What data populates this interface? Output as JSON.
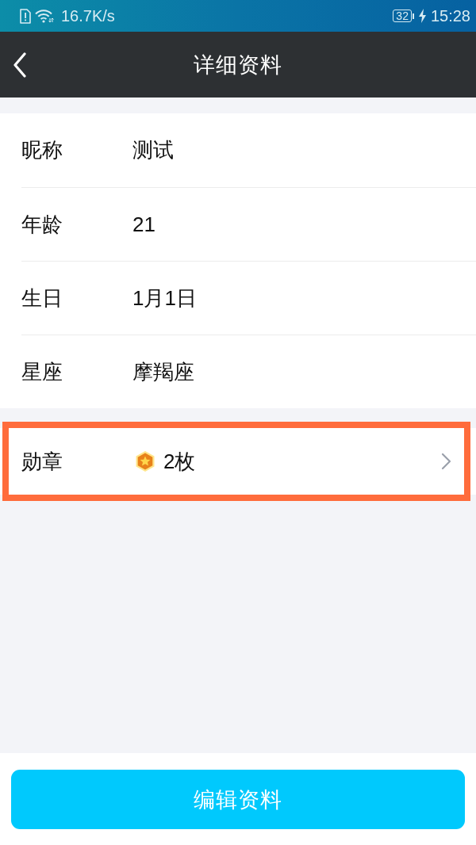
{
  "status_bar": {
    "network_speed": "16.7K/s",
    "battery": "32",
    "charging": true,
    "time": "15:28"
  },
  "nav_bar": {
    "title": "详细资料"
  },
  "profile_fields": [
    {
      "label": "昵称",
      "value": "测试"
    },
    {
      "label": "年龄",
      "value": "21"
    },
    {
      "label": "生日",
      "value": "1月1日"
    },
    {
      "label": "星座",
      "value": "摩羯座"
    }
  ],
  "badge_row": {
    "label": "勋章",
    "value": "2枚",
    "highlighted": true
  },
  "edit_button": {
    "label": "编辑资料"
  }
}
